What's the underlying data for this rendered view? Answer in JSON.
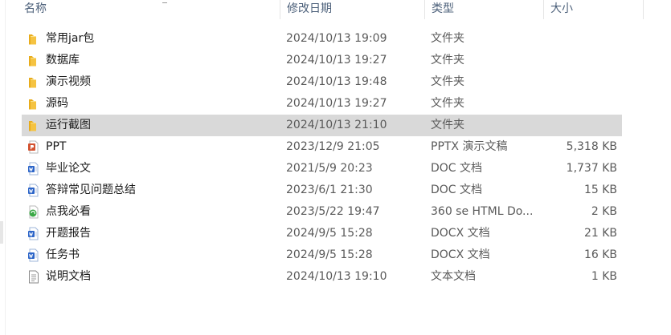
{
  "columns": {
    "name": "名称",
    "date": "修改日期",
    "type": "类型",
    "size": "大小"
  },
  "rows": [
    {
      "name": "常用jar包",
      "date": "2024/10/13 19:09",
      "type": "文件夹",
      "size": "",
      "icon": "folder-icon",
      "selected": false
    },
    {
      "name": "数据库",
      "date": "2024/10/13 19:27",
      "type": "文件夹",
      "size": "",
      "icon": "folder-icon",
      "selected": false
    },
    {
      "name": "演示视频",
      "date": "2024/10/13 19:48",
      "type": "文件夹",
      "size": "",
      "icon": "folder-icon",
      "selected": false
    },
    {
      "name": "源码",
      "date": "2024/10/13 19:27",
      "type": "文件夹",
      "size": "",
      "icon": "folder-icon",
      "selected": false
    },
    {
      "name": "运行截图",
      "date": "2024/10/13 21:10",
      "type": "文件夹",
      "size": "",
      "icon": "folder-icon",
      "selected": true
    },
    {
      "name": "PPT",
      "date": "2023/12/9 21:05",
      "type": "PPTX 演示文稿",
      "size": "5,318 KB",
      "icon": "pptx-file-icon",
      "selected": false
    },
    {
      "name": "毕业论文",
      "date": "2021/5/9 20:23",
      "type": "DOC 文档",
      "size": "1,737 KB",
      "icon": "word-doc-icon",
      "selected": false
    },
    {
      "name": "答辩常见问题总结",
      "date": "2023/6/1 21:30",
      "type": "DOC 文档",
      "size": "15 KB",
      "icon": "word-doc-icon",
      "selected": false
    },
    {
      "name": "点我必看",
      "date": "2023/5/22 19:47",
      "type": "360 se HTML Do...",
      "size": "2 KB",
      "icon": "html-file-icon",
      "selected": false
    },
    {
      "name": "开题报告",
      "date": "2024/9/5 15:28",
      "type": "DOCX 文档",
      "size": "21 KB",
      "icon": "word-doc-icon",
      "selected": false
    },
    {
      "name": "任务书",
      "date": "2024/9/5 15:28",
      "type": "DOCX 文档",
      "size": "16 KB",
      "icon": "word-doc-icon",
      "selected": false
    },
    {
      "name": "说明文档",
      "date": "2024/10/13 19:10",
      "type": "文本文档",
      "size": "1 KB",
      "icon": "text-file-icon",
      "selected": false
    }
  ],
  "colors": {
    "selected_row": "#d9d9d9",
    "header_text": "#4c607a",
    "folder": "#f5c342",
    "word_blue": "#2b64c8",
    "ppt_orange": "#d35230",
    "html_green": "#3aa845"
  }
}
